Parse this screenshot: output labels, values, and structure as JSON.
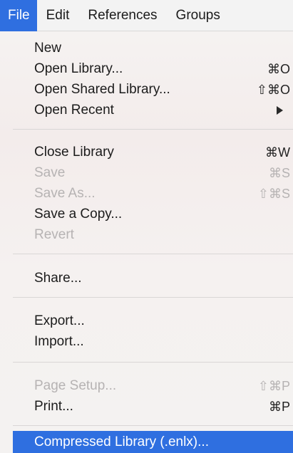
{
  "menubar": {
    "items": [
      {
        "label": "File",
        "active": true
      },
      {
        "label": "Edit"
      },
      {
        "label": "References"
      },
      {
        "label": "Groups"
      }
    ]
  },
  "menu": {
    "items": [
      {
        "label": "New",
        "shortcut": ""
      },
      {
        "label": "Open Library...",
        "shortcut": "⌘O"
      },
      {
        "label": "Open Shared Library...",
        "shortcut": "⇧⌘O"
      },
      {
        "label": "Open Recent",
        "shortcut": "",
        "submenu": true
      },
      {
        "label": "Close Library",
        "shortcut": "⌘W"
      },
      {
        "label": "Save",
        "shortcut": "⌘S",
        "disabled": true
      },
      {
        "label": "Save As...",
        "shortcut": "⇧⌘S",
        "disabled": true
      },
      {
        "label": "Save a Copy...",
        "shortcut": ""
      },
      {
        "label": "Revert",
        "shortcut": "",
        "disabled": true
      },
      {
        "label": "Share...",
        "shortcut": ""
      },
      {
        "label": "Export...",
        "shortcut": ""
      },
      {
        "label": "Import...",
        "shortcut": ""
      },
      {
        "label": "Page Setup...",
        "shortcut": "⇧⌘P",
        "disabled": true
      },
      {
        "label": "Print...",
        "shortcut": "⌘P"
      },
      {
        "label": "Compressed Library (.enlx)...",
        "shortcut": "",
        "highlighted": true
      }
    ]
  },
  "colors": {
    "highlight": "#2f6fe0",
    "disabled_text": "#b6b3b3"
  }
}
